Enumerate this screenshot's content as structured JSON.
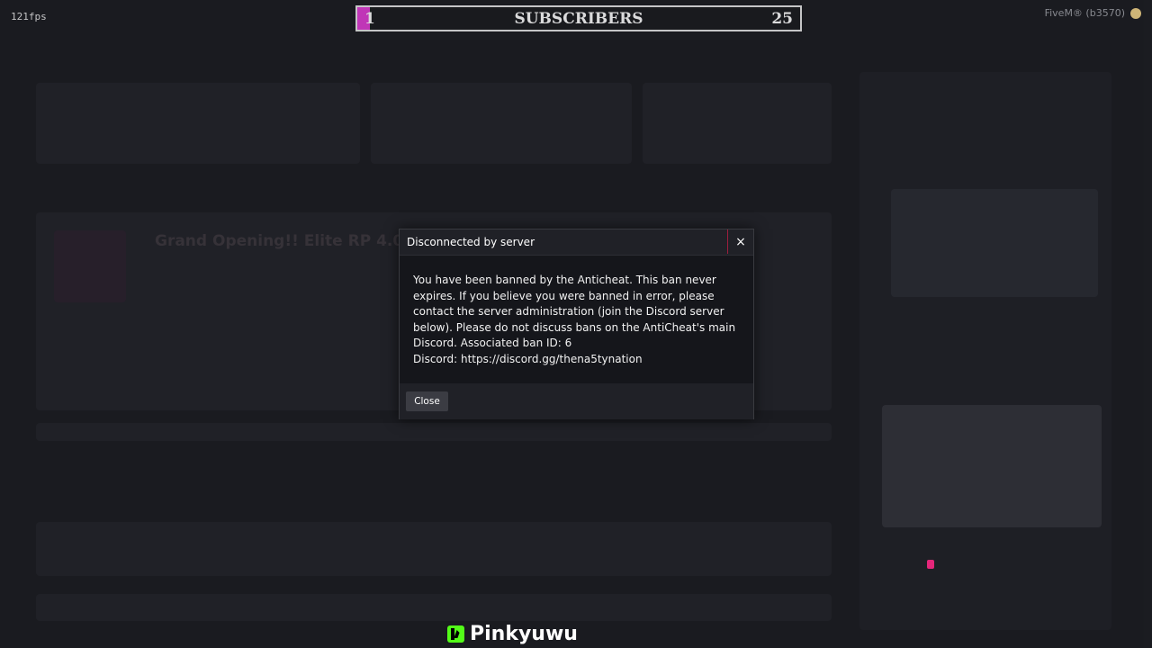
{
  "overlay": {
    "fps": "121fps",
    "brand": "FiveM® (b3570)"
  },
  "subscriber_bar": {
    "current": "1",
    "label": "SUBSCRIBERS",
    "goal": "25",
    "fill_color": "#e13fd5"
  },
  "dialog": {
    "title": "Disconnected by server",
    "close_icon": "×",
    "message": "You have been banned by the Anticheat. This ban never expires. If you believe you were banned in error, please contact the server administration (join the Discord server below). Please do not discuss bans on the AntiCheat's main Discord. Associated ban ID: 6",
    "discord": "Discord: https://discord.gg/thena5tynation",
    "close_button": "Close"
  },
  "background": {
    "server_name": "Grand Opening!! Elite RP 4.0"
  },
  "watermark": {
    "name": "Pinkyuwu",
    "logo": "kick-logo"
  }
}
